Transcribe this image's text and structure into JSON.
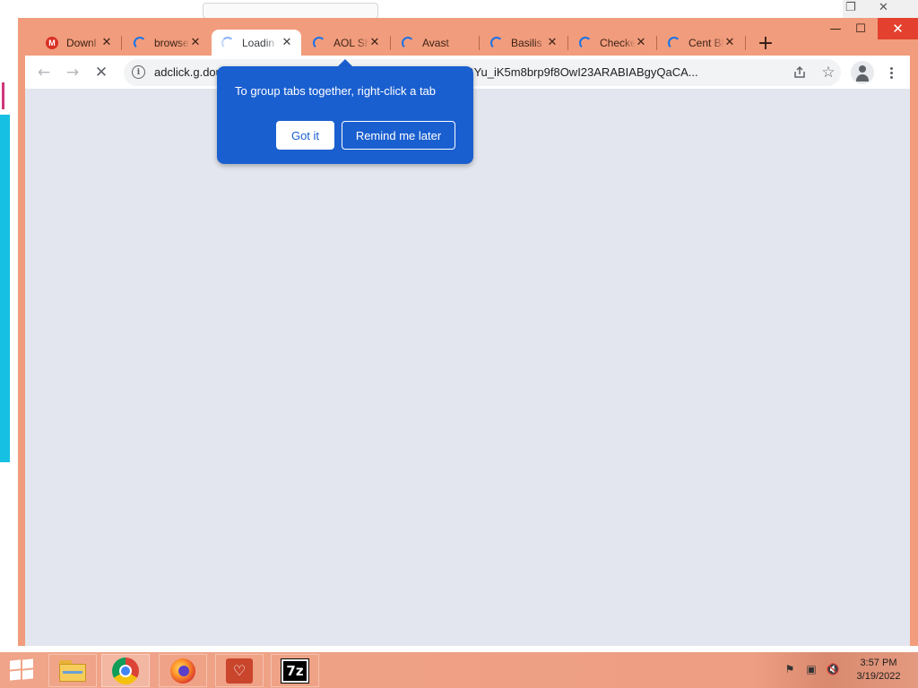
{
  "browser": {
    "tabs": [
      {
        "title": "Downl",
        "favicon": "gmail-m-icon",
        "active": false
      },
      {
        "title": "browse",
        "favicon": "loading-spinner-icon",
        "active": false
      },
      {
        "title": "Loadin",
        "favicon": "loading-spinner-icon",
        "active": true
      },
      {
        "title": "AOL Sh",
        "favicon": "loading-spinner-icon",
        "active": false
      },
      {
        "title": "Avast",
        "favicon": "loading-spinner-icon",
        "active": false
      },
      {
        "title": "Basilis",
        "favicon": "loading-spinner-icon",
        "active": false
      },
      {
        "title": "Checke",
        "favicon": "loading-spinner-icon",
        "active": false
      },
      {
        "title": "Cent Bl",
        "favicon": "loading-spinner-icon",
        "active": false
      }
    ],
    "gmail_letter": "M",
    "new_tab_label": "+",
    "url": "adclick.g.doubleclick.net/pcs/click?xai=AKAOjsuTI_gTFmq2IBYu_iK5m8brp9f8OwI23ARABIABgyQaCA...",
    "accent_color": "#f19c7c"
  },
  "tooltip": {
    "message": "To group tabs together, right-click a tab",
    "got_it_label": "Got it",
    "remind_label": "Remind me later",
    "color": "#1a5fd0"
  },
  "taskbar": {
    "apps": [
      "file-explorer-icon",
      "chrome-icon",
      "firefox-icon",
      "health-monitor-icon",
      "7zip-icon"
    ],
    "sevenzip_label": "7z",
    "time": "3:57 PM",
    "date": "3/19/2022"
  }
}
